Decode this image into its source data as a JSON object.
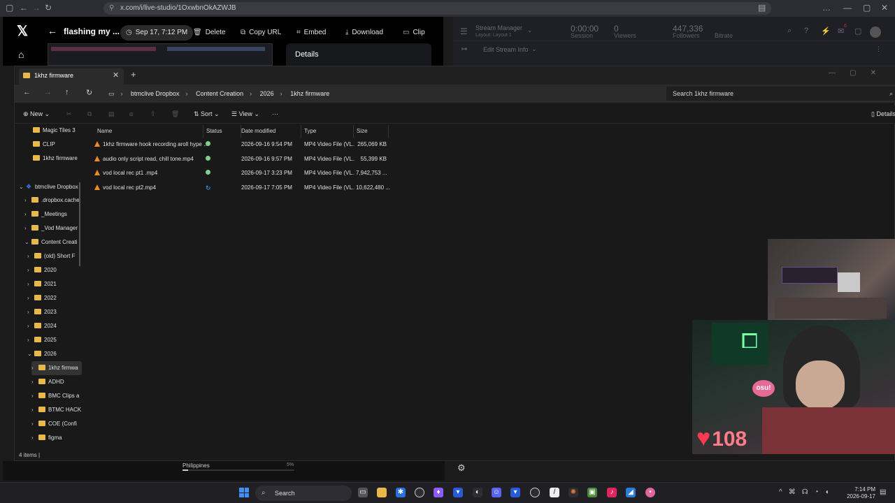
{
  "browser": {
    "url": "x.com/i/live-studio/1OxwbnOkAZWJB",
    "window_controls": [
      "…",
      "—",
      "▢",
      "✕"
    ]
  },
  "x_header": {
    "title": "flashing my ...",
    "date": "Sep 17, 7:12 PM",
    "buttons": {
      "delete": "Delete",
      "copy_url": "Copy URL",
      "embed": "Embed",
      "download": "Download",
      "clip": "Clip"
    },
    "details": "Details"
  },
  "stream_manager": {
    "title": "Stream Manager",
    "layout": "Layout: Layout 1",
    "session_value": "0:00:00",
    "session_label": "Session",
    "viewers_value": "0",
    "viewers_label": "Viewers",
    "followers_value": "447,336",
    "followers_label": "Followers",
    "bitrate_label": "Bitrate",
    "edit_stream_info": "Edit Stream Info",
    "notification_count": "6"
  },
  "explorer": {
    "tab_label": "1khz firmware",
    "breadcrumbs": [
      "btmclive Dropbox",
      "Content Creation",
      "2026",
      "1khz firmware"
    ],
    "search_placeholder": "Search 1khz firmware",
    "commands": {
      "new": "New",
      "sort": "Sort",
      "view": "View",
      "more": "···",
      "details": "Details"
    },
    "tree": [
      {
        "label": "Magic Tiles 3",
        "level": 0,
        "chev": ""
      },
      {
        "label": "CLIP",
        "level": 0,
        "chev": ""
      },
      {
        "label": "1khz firmware",
        "level": 0,
        "chev": ""
      },
      {
        "label": "btmclive Dropbox",
        "level": 0,
        "chev": "v"
      },
      {
        "label": ".dropbox.cache",
        "level": 1,
        "chev": ">"
      },
      {
        "label": "_Meetings",
        "level": 1,
        "chev": ">"
      },
      {
        "label": "_Vod Manager",
        "level": 1,
        "chev": ">"
      },
      {
        "label": "Content Creati",
        "level": 1,
        "chev": "v"
      },
      {
        "label": "(old) Short F",
        "level": 2,
        "chev": ">"
      },
      {
        "label": "2020",
        "level": 2,
        "chev": ">"
      },
      {
        "label": "2021",
        "level": 2,
        "chev": ">"
      },
      {
        "label": "2022",
        "level": 2,
        "chev": ">"
      },
      {
        "label": "2023",
        "level": 2,
        "chev": ">"
      },
      {
        "label": "2024",
        "level": 2,
        "chev": ">"
      },
      {
        "label": "2025",
        "level": 2,
        "chev": ">"
      },
      {
        "label": "2026",
        "level": 2,
        "chev": "v"
      },
      {
        "label": "1khz firmwa",
        "level": 3,
        "chev": ">"
      },
      {
        "label": "ADHD",
        "level": 3,
        "chev": ">"
      },
      {
        "label": "BMC Clips a",
        "level": 3,
        "chev": ">"
      },
      {
        "label": "BTMC HACK",
        "level": 3,
        "chev": ">"
      },
      {
        "label": "COE (Confi",
        "level": 3,
        "chev": ">"
      },
      {
        "label": "figma",
        "level": 3,
        "chev": ">"
      }
    ],
    "columns": [
      "Name",
      "Status",
      "Date modified",
      "Type",
      "Size"
    ],
    "files": [
      {
        "name": "1khz firmware hook recording aroll hype ...",
        "status": "ok",
        "date": "2026-09-16 9:54 PM",
        "type": "MP4 Video File (VL...",
        "size": "265,069 KB"
      },
      {
        "name": "audio only script read, chill tone.mp4",
        "status": "ok",
        "date": "2026-09-16 9:57 PM",
        "type": "MP4 Video File (VL...",
        "size": "55,399 KB"
      },
      {
        "name": "vod local rec pt1 .mp4",
        "status": "ok",
        "date": "2026-09-17 3:23 PM",
        "type": "MP4 Video File (VL...",
        "size": "7,942,753 ..."
      },
      {
        "name": "vod local rec pt2.mp4",
        "status": "sync",
        "date": "2026-09-17 7:05 PM",
        "type": "MP4 Video File (VL...",
        "size": "10,622,480 ..."
      }
    ],
    "status_text": "4 items  |"
  },
  "bottom": {
    "location": "Philippines",
    "percent": "5%"
  },
  "overlay": {
    "heart_count": "108",
    "osu_label": "osu!"
  },
  "taskbar": {
    "search_label": "Search",
    "time": "7:14 PM",
    "date": "2026-09-17"
  }
}
